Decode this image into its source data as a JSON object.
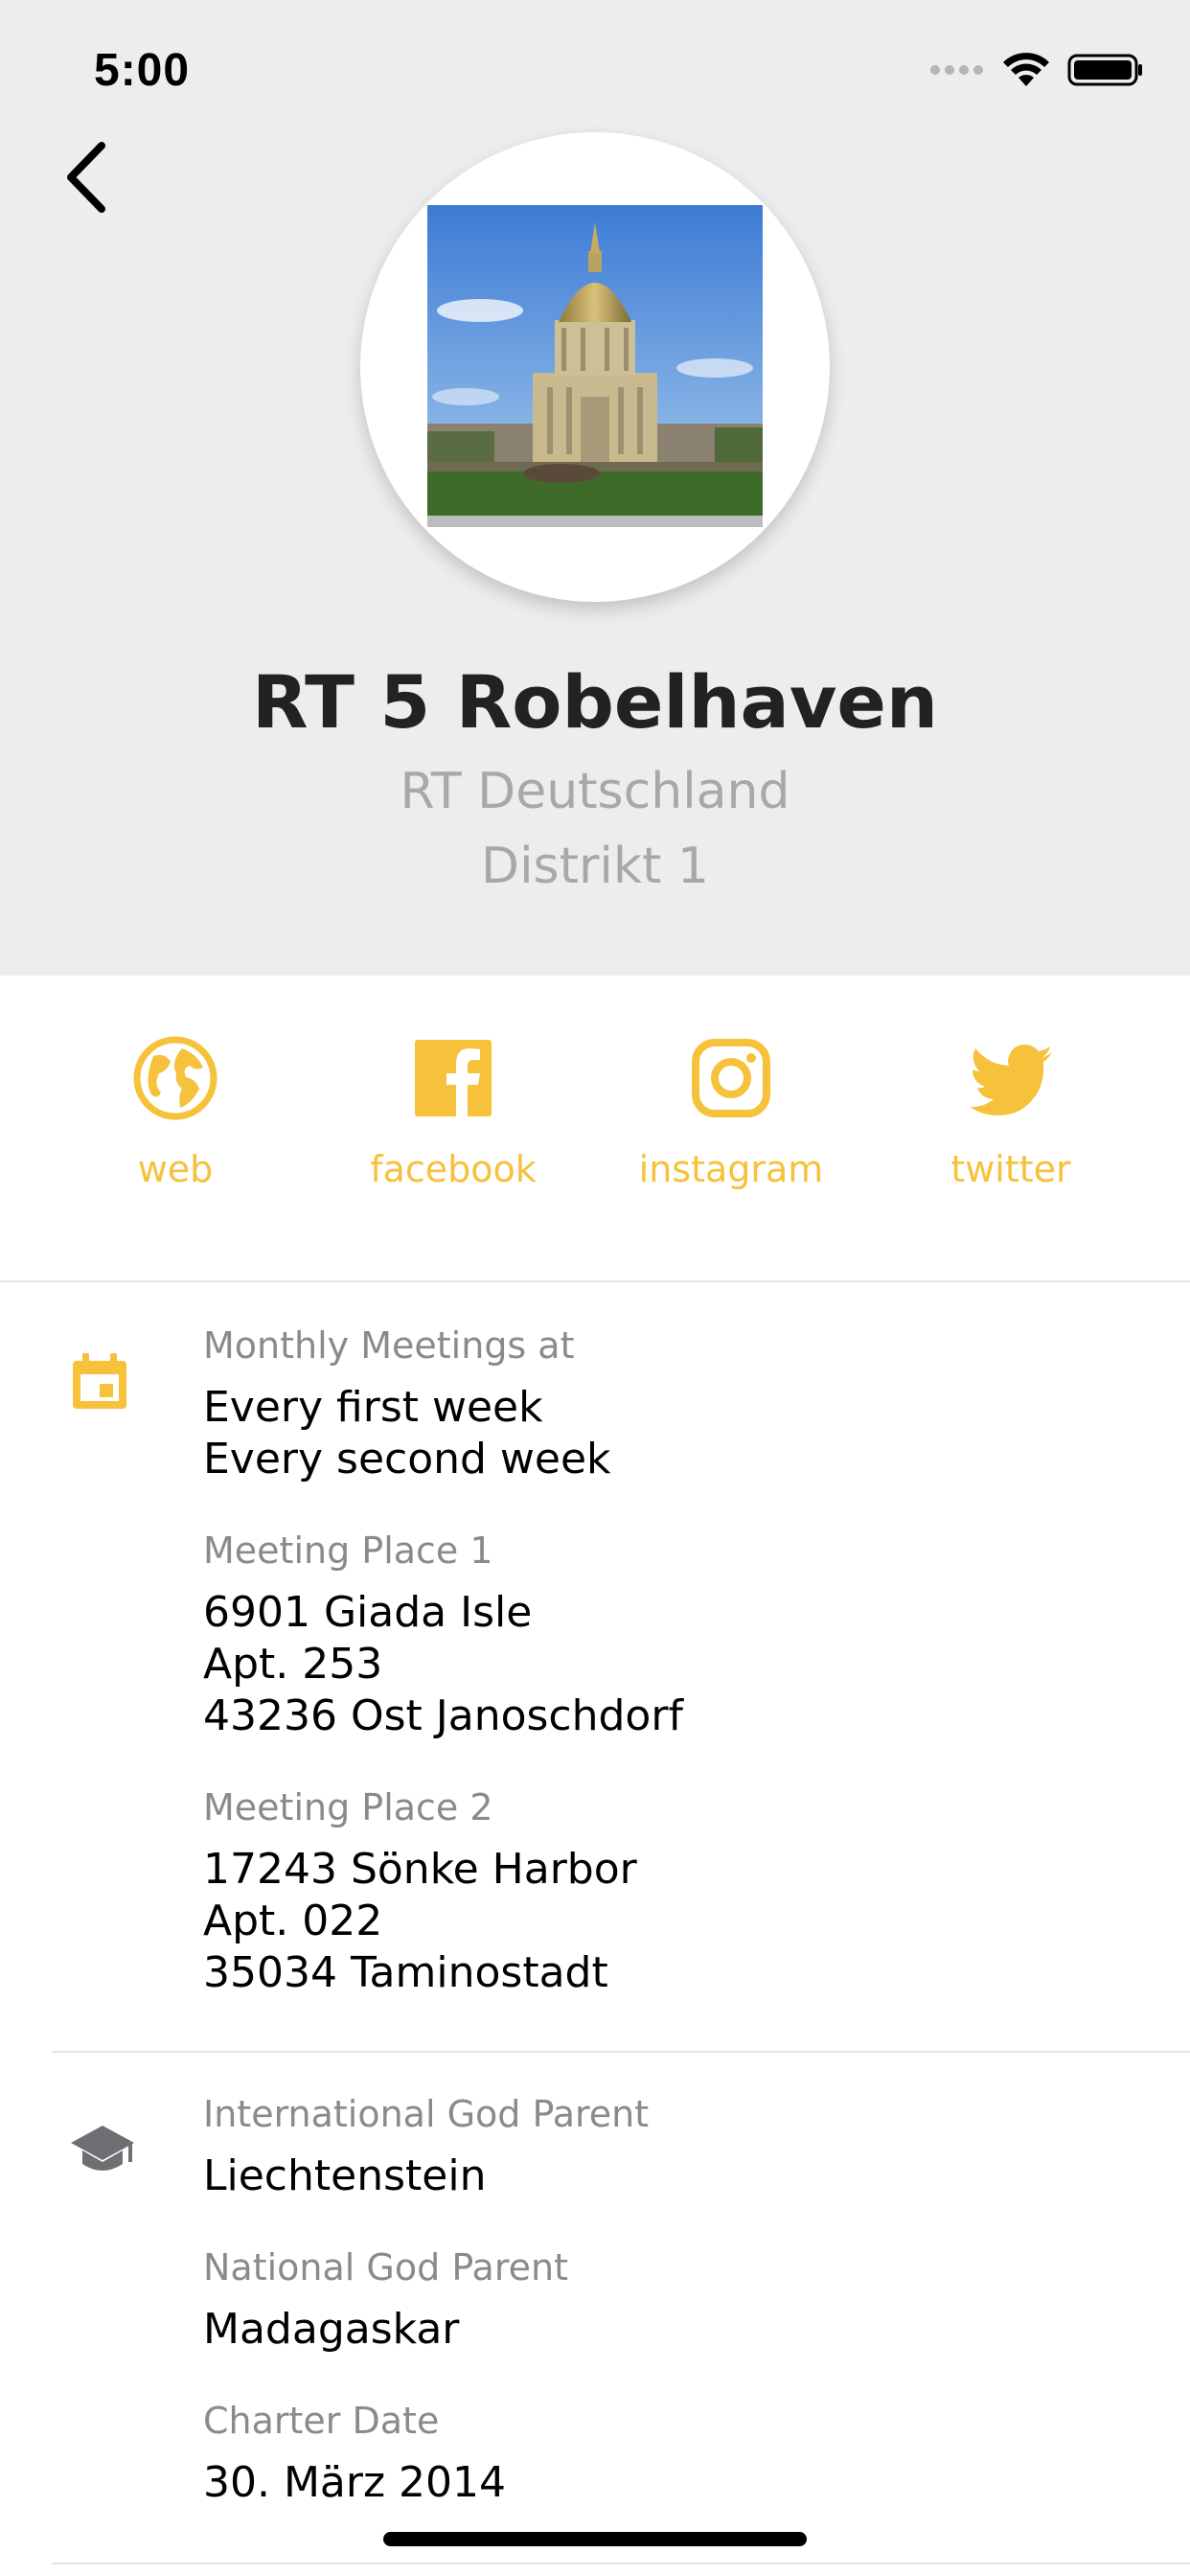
{
  "status_bar": {
    "time": "5:00",
    "icons": [
      "signal-icon",
      "wifi-icon",
      "battery-icon"
    ]
  },
  "header": {
    "back_icon": "chevron-left-icon",
    "club_name": "RT 5 Robelhaven",
    "country": "RT Deutschland",
    "district": "Distrikt 1"
  },
  "social": [
    {
      "label": "web",
      "icon": "globe-icon"
    },
    {
      "label": "facebook",
      "icon": "facebook-icon"
    },
    {
      "label": "instagram",
      "icon": "instagram-icon"
    },
    {
      "label": "twitter",
      "icon": "twitter-icon"
    }
  ],
  "meetings": {
    "icon": "calendar-icon",
    "monthly_label": "Monthly Meetings at",
    "monthly_lines": [
      "Every first week",
      "Every second week"
    ],
    "place1_label": "Meeting Place 1",
    "place1_lines": [
      "6901 Giada Isle",
      "Apt. 253",
      "43236 Ost Janoschdorf"
    ],
    "place2_label": "Meeting Place 2",
    "place2_lines": [
      "17243 Sönke Harbor",
      "Apt. 022",
      "35034 Taminostadt"
    ]
  },
  "parents": {
    "icon": "graduation-cap-icon",
    "international_label": "International God Parent",
    "international_value": "Liechtenstein",
    "national_label": "National God Parent",
    "national_value": "Madagaskar",
    "charter_label": "Charter Date",
    "charter_value": "30. März 2014"
  },
  "colors": {
    "accent": "#f6c13b",
    "header_bg": "#ededef",
    "muted": "#8a8a8e"
  }
}
